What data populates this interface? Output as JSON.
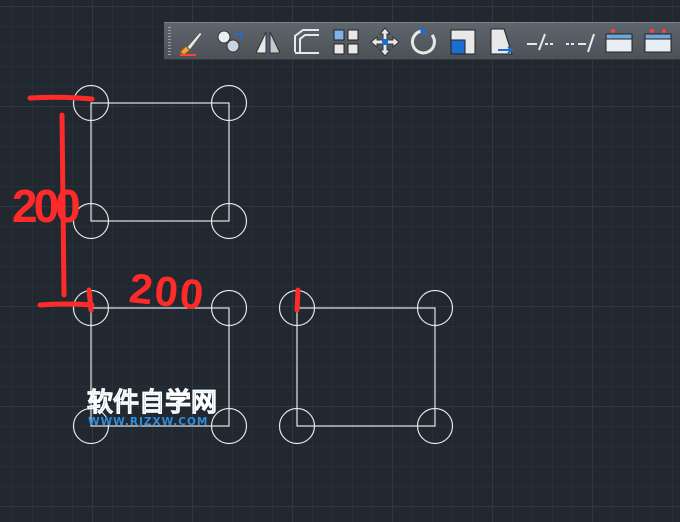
{
  "toolbar": {
    "tools": [
      {
        "name": "match-properties-icon"
      },
      {
        "name": "copy-icon"
      },
      {
        "name": "mirror-icon"
      },
      {
        "name": "offset-icon"
      },
      {
        "name": "array-icon"
      },
      {
        "name": "move-icon"
      },
      {
        "name": "rotate-icon"
      },
      {
        "name": "scale-icon"
      },
      {
        "name": "stretch-icon"
      },
      {
        "name": "trim-icon"
      },
      {
        "name": "extend-icon"
      },
      {
        "name": "break-at-point-icon"
      },
      {
        "name": "break-icon"
      }
    ]
  },
  "annotations": {
    "vertical_dimension": "200",
    "horizontal_dimension": "200",
    "corner_mark_a": "1",
    "corner_mark_b": "1"
  },
  "watermark": {
    "title": "软件自学网",
    "url": "WWW.RJZXW.COM"
  },
  "colors": {
    "background": "#212830",
    "geometry": "#e6e6e6",
    "annotation": "#ff2a2a",
    "watermark": "#2e8ddc"
  }
}
